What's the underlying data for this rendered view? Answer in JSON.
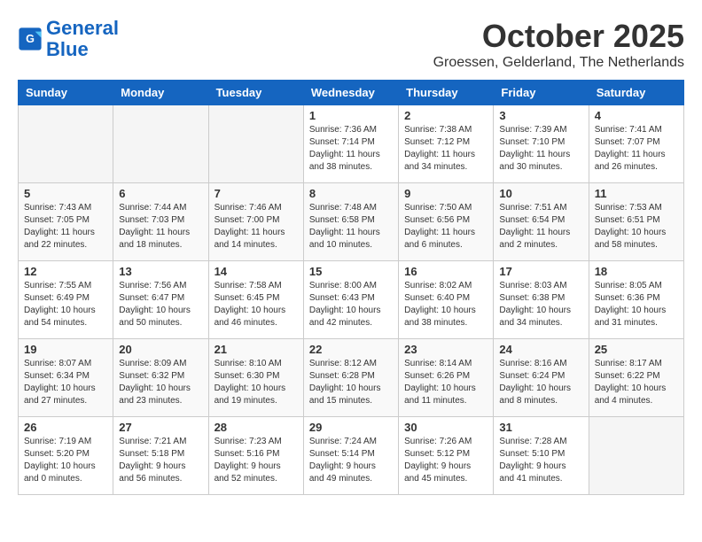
{
  "header": {
    "logo_line1": "General",
    "logo_line2": "Blue",
    "month_title": "October 2025",
    "location": "Groessen, Gelderland, The Netherlands"
  },
  "calendar": {
    "days_of_week": [
      "Sunday",
      "Monday",
      "Tuesday",
      "Wednesday",
      "Thursday",
      "Friday",
      "Saturday"
    ],
    "weeks": [
      [
        {
          "day": "",
          "info": ""
        },
        {
          "day": "",
          "info": ""
        },
        {
          "day": "",
          "info": ""
        },
        {
          "day": "1",
          "info": "Sunrise: 7:36 AM\nSunset: 7:14 PM\nDaylight: 11 hours and 38 minutes."
        },
        {
          "day": "2",
          "info": "Sunrise: 7:38 AM\nSunset: 7:12 PM\nDaylight: 11 hours and 34 minutes."
        },
        {
          "day": "3",
          "info": "Sunrise: 7:39 AM\nSunset: 7:10 PM\nDaylight: 11 hours and 30 minutes."
        },
        {
          "day": "4",
          "info": "Sunrise: 7:41 AM\nSunset: 7:07 PM\nDaylight: 11 hours and 26 minutes."
        }
      ],
      [
        {
          "day": "5",
          "info": "Sunrise: 7:43 AM\nSunset: 7:05 PM\nDaylight: 11 hours and 22 minutes."
        },
        {
          "day": "6",
          "info": "Sunrise: 7:44 AM\nSunset: 7:03 PM\nDaylight: 11 hours and 18 minutes."
        },
        {
          "day": "7",
          "info": "Sunrise: 7:46 AM\nSunset: 7:00 PM\nDaylight: 11 hours and 14 minutes."
        },
        {
          "day": "8",
          "info": "Sunrise: 7:48 AM\nSunset: 6:58 PM\nDaylight: 11 hours and 10 minutes."
        },
        {
          "day": "9",
          "info": "Sunrise: 7:50 AM\nSunset: 6:56 PM\nDaylight: 11 hours and 6 minutes."
        },
        {
          "day": "10",
          "info": "Sunrise: 7:51 AM\nSunset: 6:54 PM\nDaylight: 11 hours and 2 minutes."
        },
        {
          "day": "11",
          "info": "Sunrise: 7:53 AM\nSunset: 6:51 PM\nDaylight: 10 hours and 58 minutes."
        }
      ],
      [
        {
          "day": "12",
          "info": "Sunrise: 7:55 AM\nSunset: 6:49 PM\nDaylight: 10 hours and 54 minutes."
        },
        {
          "day": "13",
          "info": "Sunrise: 7:56 AM\nSunset: 6:47 PM\nDaylight: 10 hours and 50 minutes."
        },
        {
          "day": "14",
          "info": "Sunrise: 7:58 AM\nSunset: 6:45 PM\nDaylight: 10 hours and 46 minutes."
        },
        {
          "day": "15",
          "info": "Sunrise: 8:00 AM\nSunset: 6:43 PM\nDaylight: 10 hours and 42 minutes."
        },
        {
          "day": "16",
          "info": "Sunrise: 8:02 AM\nSunset: 6:40 PM\nDaylight: 10 hours and 38 minutes."
        },
        {
          "day": "17",
          "info": "Sunrise: 8:03 AM\nSunset: 6:38 PM\nDaylight: 10 hours and 34 minutes."
        },
        {
          "day": "18",
          "info": "Sunrise: 8:05 AM\nSunset: 6:36 PM\nDaylight: 10 hours and 31 minutes."
        }
      ],
      [
        {
          "day": "19",
          "info": "Sunrise: 8:07 AM\nSunset: 6:34 PM\nDaylight: 10 hours and 27 minutes."
        },
        {
          "day": "20",
          "info": "Sunrise: 8:09 AM\nSunset: 6:32 PM\nDaylight: 10 hours and 23 minutes."
        },
        {
          "day": "21",
          "info": "Sunrise: 8:10 AM\nSunset: 6:30 PM\nDaylight: 10 hours and 19 minutes."
        },
        {
          "day": "22",
          "info": "Sunrise: 8:12 AM\nSunset: 6:28 PM\nDaylight: 10 hours and 15 minutes."
        },
        {
          "day": "23",
          "info": "Sunrise: 8:14 AM\nSunset: 6:26 PM\nDaylight: 10 hours and 11 minutes."
        },
        {
          "day": "24",
          "info": "Sunrise: 8:16 AM\nSunset: 6:24 PM\nDaylight: 10 hours and 8 minutes."
        },
        {
          "day": "25",
          "info": "Sunrise: 8:17 AM\nSunset: 6:22 PM\nDaylight: 10 hours and 4 minutes."
        }
      ],
      [
        {
          "day": "26",
          "info": "Sunrise: 7:19 AM\nSunset: 5:20 PM\nDaylight: 10 hours and 0 minutes."
        },
        {
          "day": "27",
          "info": "Sunrise: 7:21 AM\nSunset: 5:18 PM\nDaylight: 9 hours and 56 minutes."
        },
        {
          "day": "28",
          "info": "Sunrise: 7:23 AM\nSunset: 5:16 PM\nDaylight: 9 hours and 52 minutes."
        },
        {
          "day": "29",
          "info": "Sunrise: 7:24 AM\nSunset: 5:14 PM\nDaylight: 9 hours and 49 minutes."
        },
        {
          "day": "30",
          "info": "Sunrise: 7:26 AM\nSunset: 5:12 PM\nDaylight: 9 hours and 45 minutes."
        },
        {
          "day": "31",
          "info": "Sunrise: 7:28 AM\nSunset: 5:10 PM\nDaylight: 9 hours and 41 minutes."
        },
        {
          "day": "",
          "info": ""
        }
      ]
    ]
  }
}
